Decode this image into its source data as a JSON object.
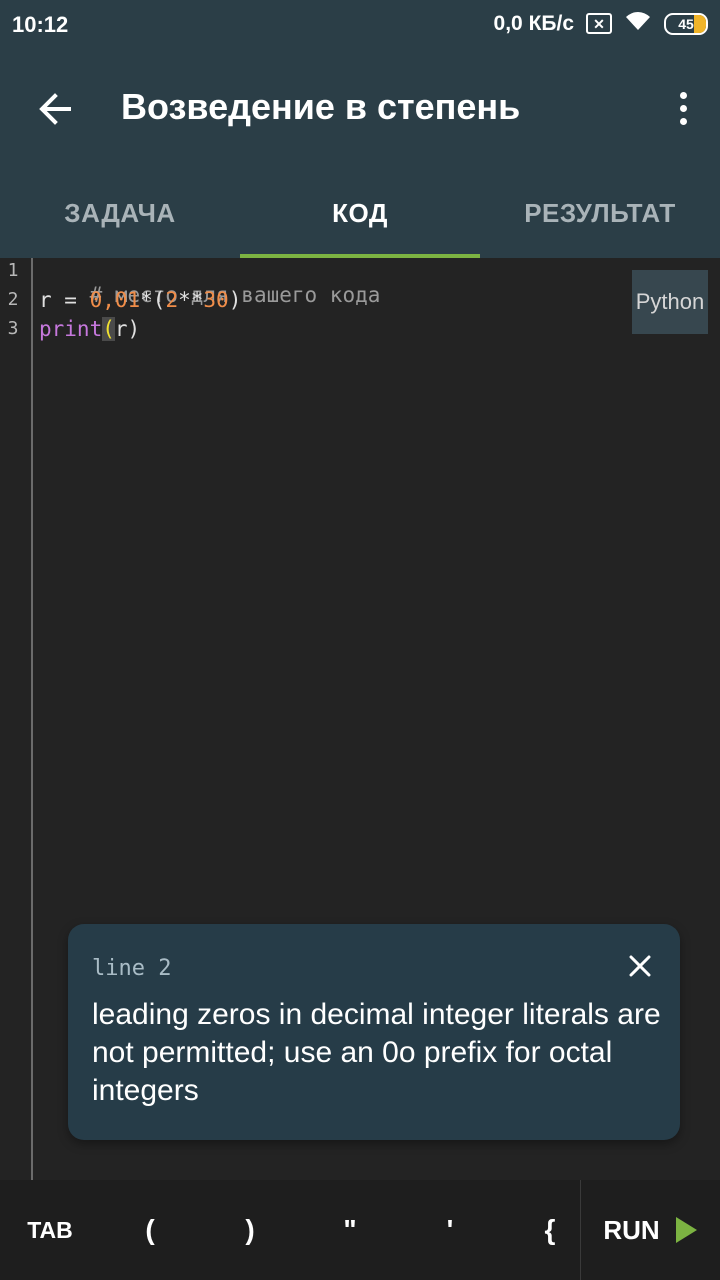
{
  "status_bar": {
    "time": "10:12",
    "net_speed": "0,0 КБ/с",
    "sim_icon": "sim-x-icon",
    "wifi_icon": "wifi-icon",
    "battery_level": "45",
    "battery_color": "#f0b429"
  },
  "app_bar": {
    "back_icon": "arrow-left-icon",
    "title": "Возведение в степень",
    "menu_icon": "more-vertical-icon"
  },
  "tabs": [
    {
      "label": "ЗАДАЧА",
      "active": false
    },
    {
      "label": "КОД",
      "active": true
    },
    {
      "label": "РЕЗУЛЬТАТ",
      "active": false
    }
  ],
  "editor": {
    "language": "Python",
    "lines": [
      {
        "number": "1",
        "text": "# место для вашего кода"
      },
      {
        "number": "2",
        "text": "r = 0,01*(2**30)"
      },
      {
        "number": "3",
        "text": "print(r)"
      }
    ],
    "line1": {
      "comment": "# место для вашего кода"
    },
    "line2": {
      "var": "r = ",
      "num1": "0,01",
      "op1": "*(",
      "num2": "2",
      "op2": "**",
      "num3": "30",
      "close": ")"
    },
    "line3": {
      "kw": "print",
      "lparen": "(",
      "arg": "r",
      "rparen": ")"
    }
  },
  "error": {
    "line": "line 2",
    "message": "leading zeros in decimal integer literals are not permitted; use an 0o prefix for octal integers",
    "close_icon": "close-icon"
  },
  "keyboard_bar": {
    "keys": [
      "TAB",
      "(",
      ")",
      "\"",
      "'",
      "{"
    ],
    "run_label": "RUN",
    "run_icon": "play-icon",
    "run_color": "#7cb342"
  },
  "colors": {
    "app_bar": "#2b3e47",
    "accent": "#7cb342",
    "editor_bg": "#232323",
    "error_card": "#263c48"
  }
}
